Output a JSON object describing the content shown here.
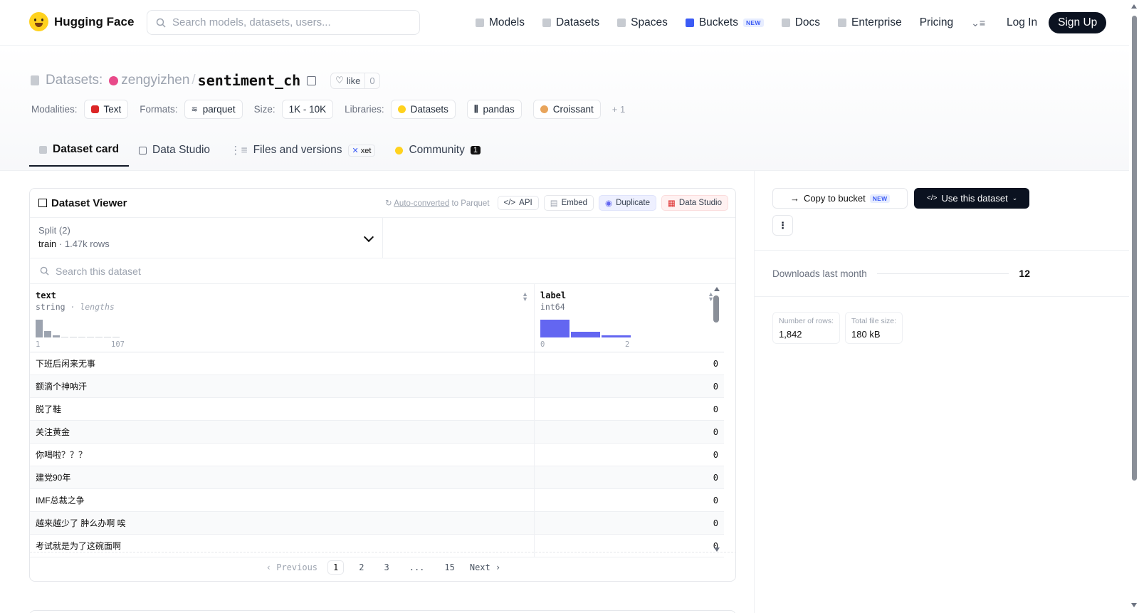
{
  "nav": {
    "logo_text": "Hugging Face",
    "search_placeholder": "Search models, datasets, users...",
    "links": [
      {
        "label": "Models",
        "icon": "cube-icon"
      },
      {
        "label": "Datasets",
        "icon": "database-icon"
      },
      {
        "label": "Spaces",
        "icon": "grid-icon"
      },
      {
        "label": "Buckets",
        "icon": "bucket-icon",
        "badge": "NEW"
      },
      {
        "label": "Docs",
        "icon": "book-icon"
      },
      {
        "label": "Enterprise",
        "icon": "enterprise-icon"
      },
      {
        "label": "Pricing"
      }
    ],
    "login": "Log In",
    "signup": "Sign Up"
  },
  "header": {
    "section_label": "Datasets:",
    "user": "zengyizhen",
    "slash": "/",
    "dataset_name": "sentiment_ch",
    "like_label": "like",
    "like_count": "0",
    "modalities_label": "Modalities:",
    "modality": "Text",
    "formats_label": "Formats:",
    "format": "parquet",
    "size_label": "Size:",
    "size": "1K - 10K",
    "libraries_label": "Libraries:",
    "libraries": [
      "Datasets",
      "pandas",
      "Croissant"
    ],
    "libraries_more": "+ 1"
  },
  "tabs": {
    "card": "Dataset card",
    "studio": "Data Studio",
    "files": "Files and versions",
    "xet": "xet",
    "community": "Community",
    "community_count": "1"
  },
  "viewer": {
    "title": "Dataset Viewer",
    "auto_converted": "Auto-converted",
    "auto_suffix": " to Parquet",
    "api": "API",
    "embed": "Embed",
    "duplicate": "Duplicate",
    "data_studio": "Data Studio",
    "split_label": "Split (2)",
    "split_name": "train",
    "split_rows": "· 1.47k rows",
    "search_placeholder": "Search this dataset",
    "columns": [
      {
        "name": "text",
        "type": "string",
        "subtype": "· lengths",
        "min": "1",
        "max": "107"
      },
      {
        "name": "label",
        "type": "int64",
        "min": "0",
        "max": "2"
      }
    ],
    "text_hist": [
      1.0,
      0.35,
      0.12,
      0.0,
      0.0,
      0.0,
      0.0,
      0.0,
      0.0,
      0.0
    ],
    "label_hist": [
      1.0,
      0.3,
      0.12
    ],
    "rows": [
      {
        "text": "下班后闲来无事",
        "label": "0"
      },
      {
        "text": "额滴个神呐汗",
        "label": "0"
      },
      {
        "text": "脱了鞋",
        "label": "0"
      },
      {
        "text": "关注黄金",
        "label": "0"
      },
      {
        "text": "你喝啦？？？",
        "label": "0"
      },
      {
        "text": "建党90年",
        "label": "0"
      },
      {
        "text": "IMF总裁之争",
        "label": "0"
      },
      {
        "text": "越来越少了  肿么办啊  唉",
        "label": "0"
      },
      {
        "text": "考试就是为了这碗面啊",
        "label": "0"
      }
    ],
    "pager": {
      "prev": "Previous",
      "pages": [
        "1",
        "2",
        "3",
        "...",
        "15"
      ],
      "next": "Next"
    }
  },
  "sidebar": {
    "copy_bucket": "Copy to bucket",
    "copy_badge": "NEW",
    "use_dataset": "Use this dataset",
    "downloads_label": "Downloads last month",
    "downloads_value": "12",
    "rows_label": "Number of rows:",
    "rows_value": "1,842",
    "filesize_label": "Total file size:",
    "filesize_value": "180 kB"
  }
}
